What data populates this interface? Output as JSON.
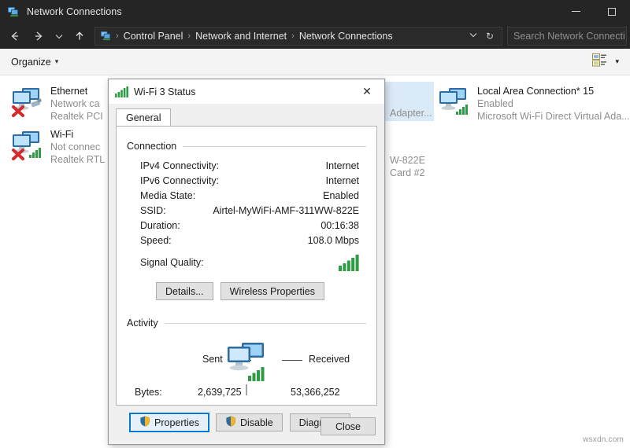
{
  "window": {
    "title": "Network Connections",
    "icon": "network-connections-icon",
    "controls": {
      "minimize": "minimize-icon",
      "maximize": "maximize-icon"
    }
  },
  "navbar": {
    "back": "back-arrow-icon",
    "forward": "forward-arrow-icon",
    "recent": "chevron-down-icon",
    "up": "up-arrow-icon",
    "breadcrumbs": [
      "Control Panel",
      "Network and Internet",
      "Network Connections"
    ],
    "separator": "›",
    "dropdown": "chevron-down-icon",
    "refresh": "↻",
    "search_placeholder": "Search Network Connecti"
  },
  "commandbar": {
    "organize": "Organize",
    "caret": "▾",
    "view_icon": "change-view-icon",
    "view_caret": "▾"
  },
  "connections": [
    {
      "name": "Ethernet",
      "status": "Network ca",
      "device": "Realtek PCI",
      "state": "disconnected",
      "selected": false
    },
    {
      "name": "Wi-Fi",
      "status": "Not connec",
      "device": "Realtek RTL",
      "state": "disconnected-wifi",
      "selected": false
    },
    {
      "name": "",
      "status": "",
      "device": "Adapter...",
      "state": "hidden-behind",
      "selected": true
    },
    {
      "name": "Local Area Connection* 15",
      "status": "Enabled",
      "device": "Microsoft Wi-Fi Direct Virtual Ada...",
      "state": "enabled-wifi",
      "selected": false
    },
    {
      "name": "",
      "status": "W-822E",
      "device": "Card #2",
      "state": "clipped",
      "selected": false
    }
  ],
  "dialog": {
    "title": "Wi-Fi 3 Status",
    "title_icon": "wifi-signal-icon",
    "close_icon": "✕",
    "tabs": [
      {
        "label": "General",
        "active": true
      }
    ],
    "connection": {
      "group_label": "Connection",
      "rows": [
        {
          "label": "IPv4 Connectivity:",
          "value": "Internet"
        },
        {
          "label": "IPv6 Connectivity:",
          "value": "Internet"
        },
        {
          "label": "Media State:",
          "value": "Enabled"
        },
        {
          "label": "SSID:",
          "value": "Airtel-MyWiFi-AMF-311WW-822E"
        },
        {
          "label": "Duration:",
          "value": "00:16:38"
        },
        {
          "label": "Speed:",
          "value": "108.0 Mbps"
        }
      ],
      "signal_quality_label": "Signal Quality:",
      "signal_quality_bars": 5,
      "buttons": [
        {
          "label": "Details...",
          "shield": false
        },
        {
          "label": "Wireless Properties",
          "shield": false
        }
      ]
    },
    "activity": {
      "group_label": "Activity",
      "sent_label": "Sent",
      "received_label": "Received",
      "bytes_label": "Bytes:",
      "sent_bytes": "2,639,725",
      "received_bytes": "53,366,252",
      "icon": "two-monitors-icon"
    },
    "action_buttons": [
      {
        "label": "Properties",
        "shield": true,
        "focused": true
      },
      {
        "label": "Disable",
        "shield": true,
        "focused": false
      },
      {
        "label": "Diagnose",
        "shield": false,
        "focused": false
      }
    ],
    "close_button": "Close"
  },
  "watermark": "wsxdn.com",
  "colors": {
    "titlebar": "#252526",
    "accent": "#0078d7",
    "selection": "#dbeaf7",
    "signal_green": "#2e9b45",
    "dialog_bg": "#f0f0f0"
  }
}
